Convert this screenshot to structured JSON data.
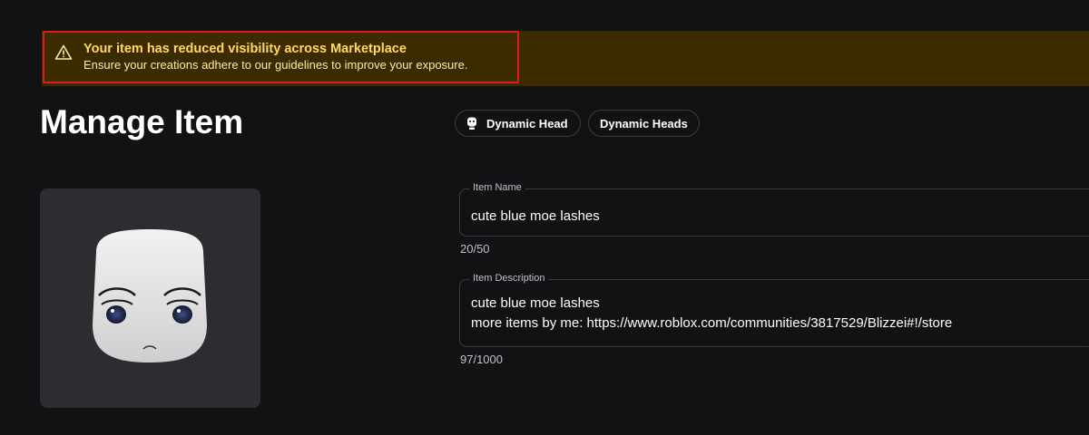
{
  "banner": {
    "icon": "warning-triangle-icon",
    "title": "Your item has reduced visibility across Marketplace",
    "subtitle": "Ensure your creations adhere to our guidelines to improve your exposure.",
    "background": "#3d2b00",
    "highlight_color": "#e01b1b"
  },
  "page": {
    "title": "Manage Item"
  },
  "chips": [
    {
      "label": "Dynamic Head",
      "icon": "dynamic-head-icon"
    },
    {
      "label": "Dynamic Heads"
    }
  ],
  "thumbnail": {
    "icon": "dynamic-head-thumbnail"
  },
  "fields": {
    "name": {
      "label": "Item Name",
      "value": "cute blue moe lashes",
      "counter": "20/50"
    },
    "description": {
      "label": "Item Description",
      "lines": [
        "cute blue moe lashes",
        "more items by me: https://www.roblox.com/communities/3817529/Blizzei#!/store"
      ],
      "counter": "97/1000"
    }
  },
  "colors": {
    "background": "#111214",
    "border": "#3a3c42",
    "warning_title": "#ffd966"
  }
}
